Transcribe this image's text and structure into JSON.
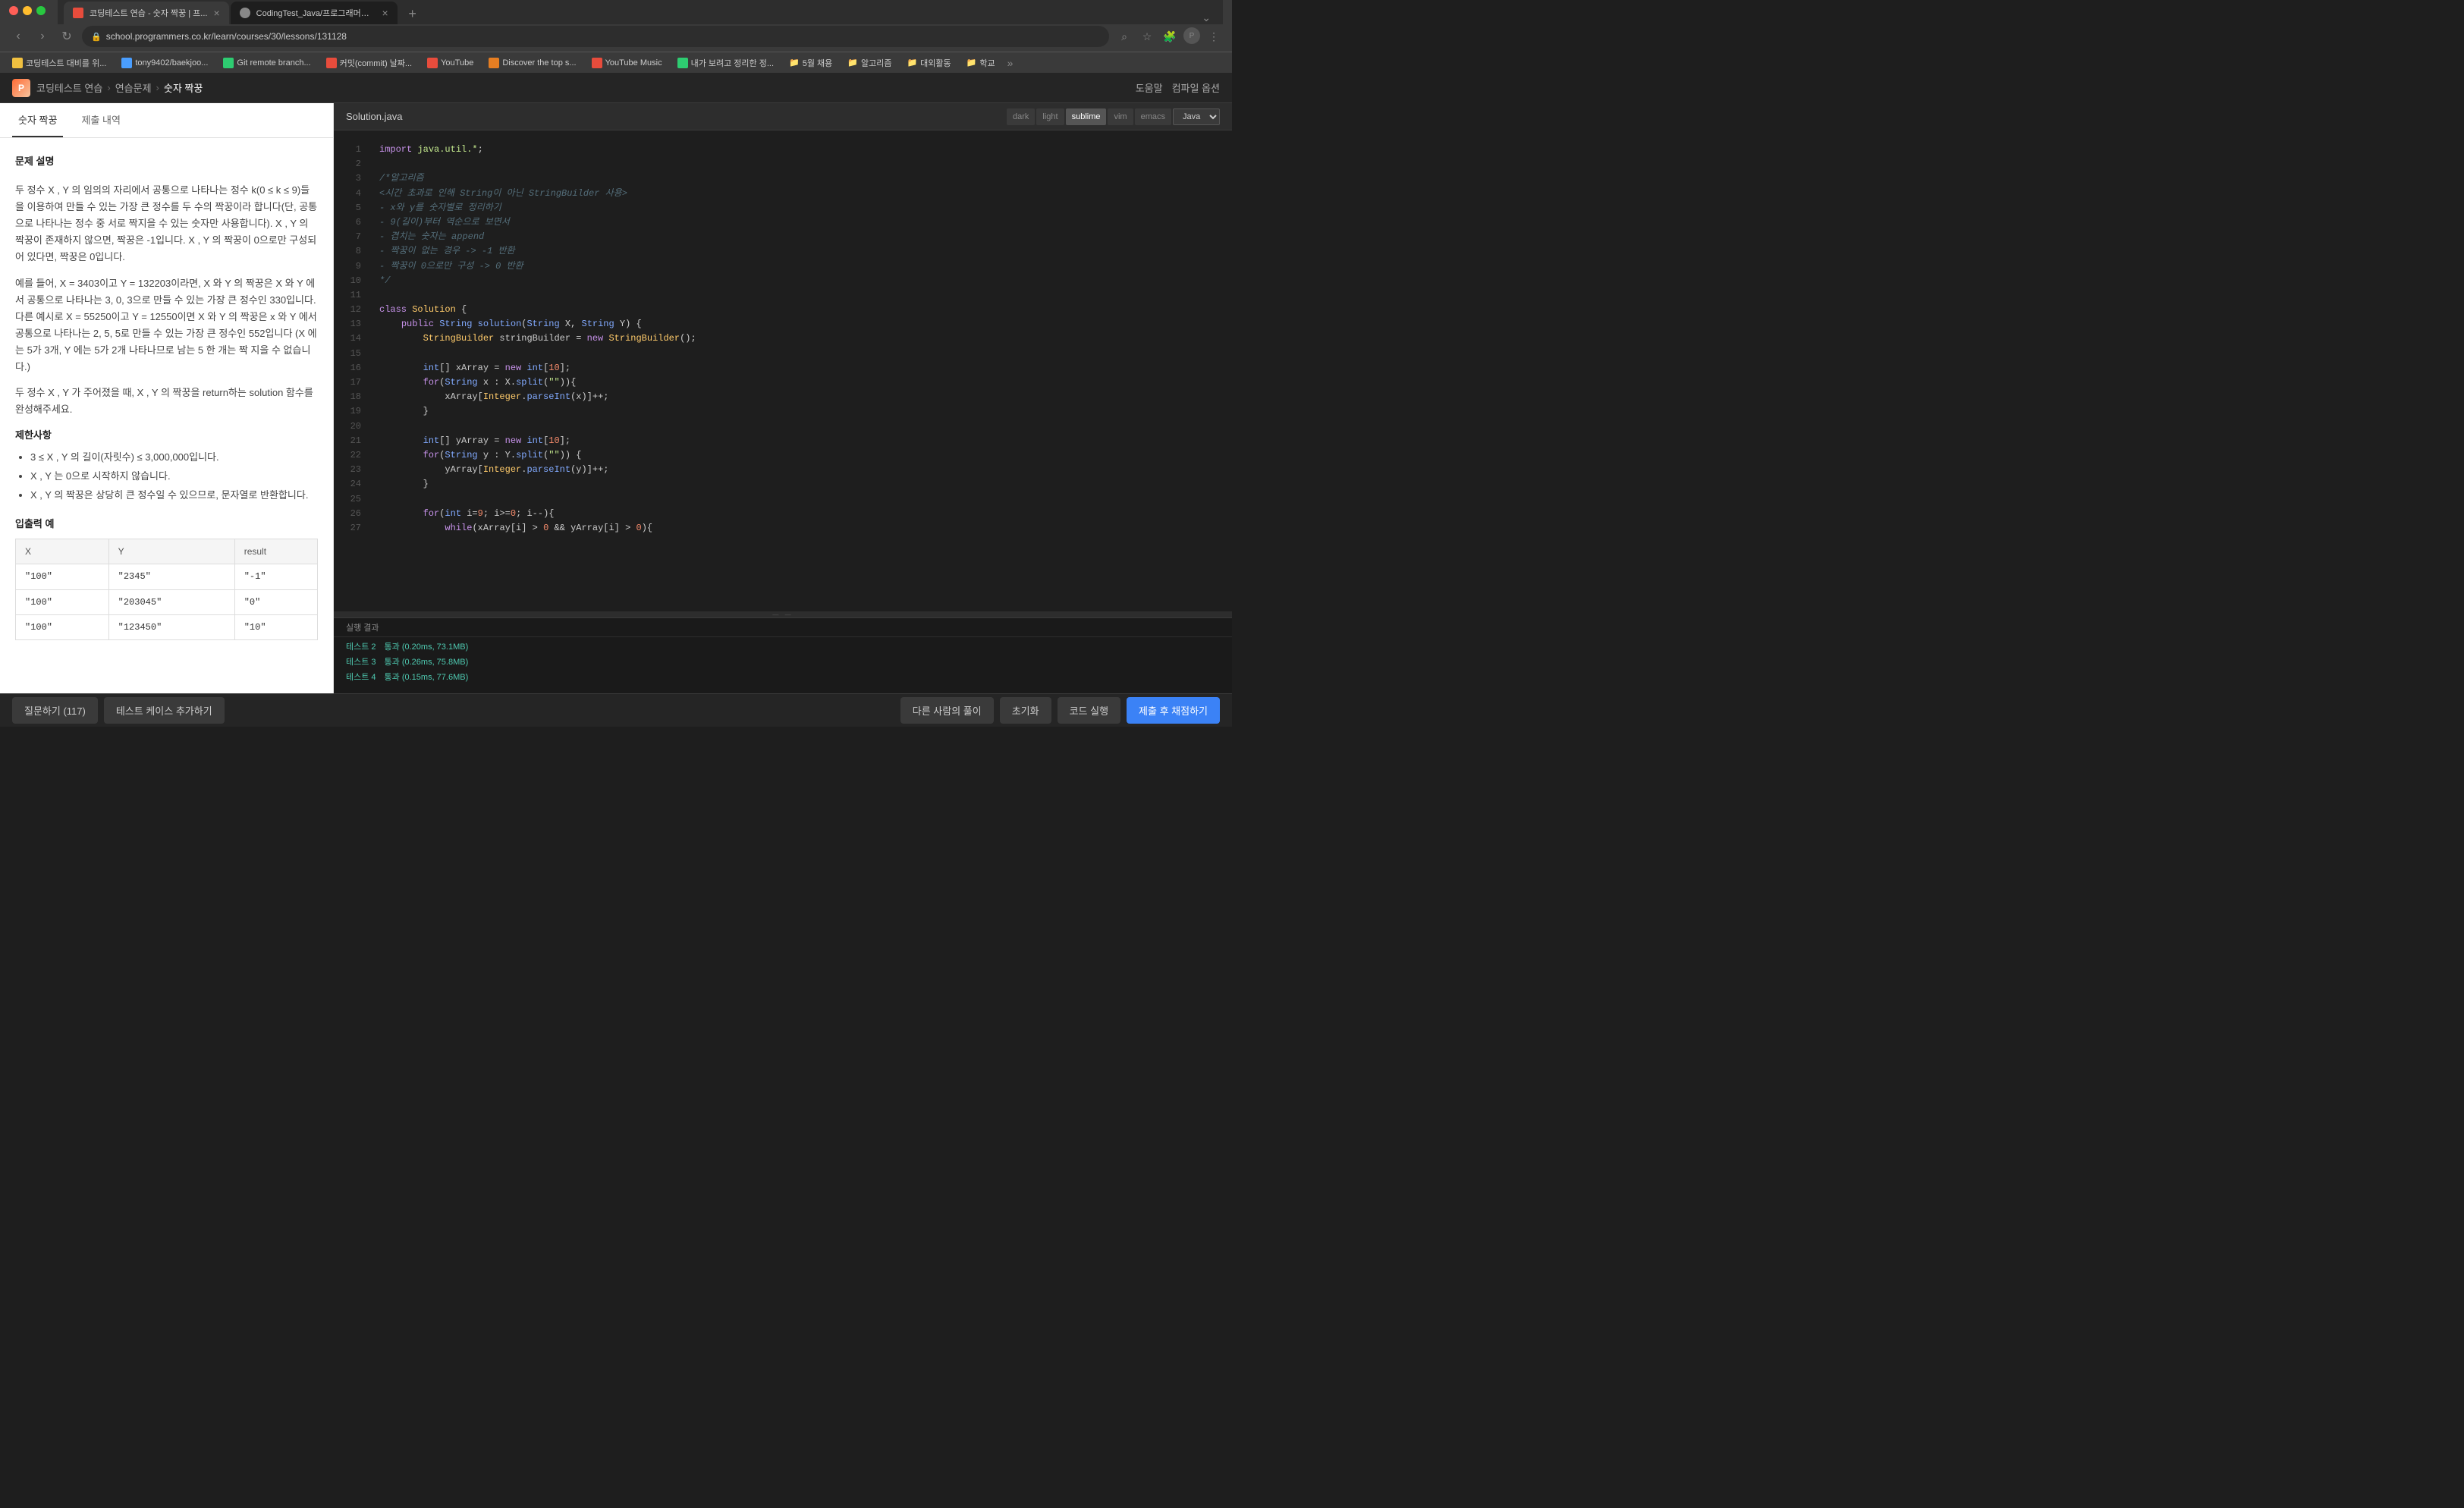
{
  "browser": {
    "tabs": [
      {
        "id": "tab1",
        "label": "코딩테스트 연습 - 숫자 짝꿍 | 프...",
        "favicon_color": "#e74c3c",
        "active": true
      },
      {
        "id": "tab2",
        "label": "CodingTest_Java/프로그래머스/...",
        "favicon_type": "github",
        "active": false
      }
    ],
    "new_tab_label": "+",
    "address": "school.programmers.co.kr/learn/courses/30/lessons/131128",
    "bookmarks": [
      {
        "id": "bm1",
        "label": "코딩테스트 대비를 위...",
        "color": "#f0c040"
      },
      {
        "id": "bm2",
        "label": "tony9402/baekjoo...",
        "color": "#4a9eff"
      },
      {
        "id": "bm3",
        "label": "Git remote branch...",
        "color": "#2ecc71"
      },
      {
        "id": "bm4",
        "label": "커밋(commit) 날짜...",
        "color": "#e74c3c"
      },
      {
        "id": "bm5",
        "label": "YouTube",
        "color": "#e74c3c"
      },
      {
        "id": "bm6",
        "label": "Discover the top s...",
        "color": "#e67e22"
      },
      {
        "id": "bm7",
        "label": "YouTube Music",
        "color": "#e74c3c"
      },
      {
        "id": "bm8",
        "label": "내가 보려고 정리한 정...",
        "color": "#2ecc71"
      },
      {
        "id": "bm9",
        "label": "5월 채용",
        "color": "#888",
        "is_folder": true
      },
      {
        "id": "bm10",
        "label": "알고리즘",
        "color": "#888",
        "is_folder": true
      },
      {
        "id": "bm11",
        "label": "대외활동",
        "color": "#888",
        "is_folder": true
      },
      {
        "id": "bm12",
        "label": "학교",
        "color": "#888",
        "is_folder": true
      }
    ]
  },
  "app": {
    "logo": "P",
    "breadcrumb": {
      "parts": [
        "코딩테스트 연습",
        "연습문제",
        "숫자 짝꿍"
      ]
    },
    "header_actions": [
      "도움말",
      "컴파일 옵션"
    ]
  },
  "tabs": {
    "problem": "숫자 짝꿍",
    "submission": "제출 내역"
  },
  "problem": {
    "description_label": "문제 설명",
    "description": [
      "두 정수 X , Y 의 임의의 자리에서 공통으로 나타나는 정수 k(0 ≤ k ≤ 9)들을 이용하여 만들 수 있는 가장 큰 정수를 두 수의 짝꿍이라 합니다(단, 공통으로 나타나는 정수 중 서로 짝지을 수 있는 숫자만 사용합니다). X , Y 의 짝꿍이 존재하지 않으면, 짝꿍은 -1입니다. X , Y 의 짝꿍이 0으로만 구성되어 있다면, 짝꿍은 0입니다.",
      "예를 들어, X = 3403이고 Y = 132203이라면, X 와 Y 의 짝꿍은 X 와 Y 에서 공통으로 나타나는 3, 0, 3으로 만들 수 있는 가장 큰 정수인 330입니다. 다른 예시로 X = 55250이고 Y = 12550이면 X 와 Y 의 짝꿍은 x 와 Y 에서 공통으로 나타나는 2, 5, 5로 만들 수 있는 가장 큰 정수인 552입니다 (X 에는 5가 3개, Y 에는 5가 2개 나타나므로 남는 5 한 개는 짝 지을 수 없습니다.)",
      "두 정수 X , Y 가 주어졌을 때, X , Y 의 짝꿍을 return하는 solution 함수를 완성해주세요."
    ],
    "constraints_label": "제한사항",
    "constraints": [
      "3 ≤ X , Y 의 길이(자릿수) ≤ 3,000,000입니다.",
      "X , Y 는 0으로 시작하지 않습니다.",
      "X , Y 의 짝꿍은 상당히 큰 정수일 수 있으므로, 문자열로 반환합니다."
    ],
    "io_label": "입출력 예",
    "io_table": {
      "headers": [
        "X",
        "Y",
        "result"
      ],
      "rows": [
        [
          "\"100\"",
          "\"2345\"",
          "\"-1\""
        ],
        [
          "\"100\"",
          "\"203045\"",
          "\"0\""
        ],
        [
          "\"100\"",
          "\"123450\"",
          "\"10\""
        ]
      ]
    }
  },
  "editor": {
    "file_name": "Solution.java",
    "themes": [
      "dark",
      "light",
      "sublime",
      "vim",
      "emacs"
    ],
    "active_theme": "sublime",
    "language": "Java",
    "line_count": 27,
    "code_lines": [
      {
        "n": 1,
        "text": "import java.util.*;"
      },
      {
        "n": 2,
        "text": ""
      },
      {
        "n": 3,
        "text": "/*알고리즘"
      },
      {
        "n": 4,
        "text": "<시간 초과로 인해 String이 아닌 StringBuilder 사용>"
      },
      {
        "n": 5,
        "text": "- x와 y를 숫자별로 정리하기"
      },
      {
        "n": 6,
        "text": "- 9(길이)부터 역순으로 보면서"
      },
      {
        "n": 7,
        "text": "  - 겹치는 숫자는 append"
      },
      {
        "n": 8,
        "text": "- 짝꿍이 없는 경우 -> -1 반환"
      },
      {
        "n": 9,
        "text": "- 짝꿍이 0으로만 구성 -> 0 반환"
      },
      {
        "n": 10,
        "text": "*/"
      },
      {
        "n": 11,
        "text": ""
      },
      {
        "n": 12,
        "text": "class Solution {"
      },
      {
        "n": 13,
        "text": "    public String solution(String X, String Y) {"
      },
      {
        "n": 14,
        "text": "        StringBuilder stringBuilder = new StringBuilder();"
      },
      {
        "n": 15,
        "text": ""
      },
      {
        "n": 16,
        "text": "        int[] xArray = new int[10];"
      },
      {
        "n": 17,
        "text": "        for(String x : X.split(\"\")) {"
      },
      {
        "n": 18,
        "text": "            xArray[Integer.parseInt(x)]++;"
      },
      {
        "n": 19,
        "text": "        }"
      },
      {
        "n": 20,
        "text": ""
      },
      {
        "n": 21,
        "text": "        int[] yArray = new int[10];"
      },
      {
        "n": 22,
        "text": "        for(String y : Y.split(\"\")) {"
      },
      {
        "n": 23,
        "text": "            yArray[Integer.parseInt(y)]++;"
      },
      {
        "n": 24,
        "text": "        }"
      },
      {
        "n": 25,
        "text": ""
      },
      {
        "n": 26,
        "text": "        for(int i=9; i>=0; i--){"
      },
      {
        "n": 27,
        "text": "            while(xArray[i] > 0 && yArray[i] > 0){"
      }
    ]
  },
  "output": {
    "label": "실행 결과",
    "results": [
      {
        "id": "test2",
        "label": "테스트 2",
        "status": "통과 (0.20ms, 73.1MB)"
      },
      {
        "id": "test3",
        "label": "테스트 3",
        "status": "통과 (0.26ms, 75.8MB)"
      },
      {
        "id": "test4",
        "label": "테스트 4",
        "status": "통과 (0.15ms, 77.6MB)"
      }
    ]
  },
  "bottom_bar": {
    "left_buttons": [
      {
        "id": "question-btn",
        "label": "질문하기 (117)"
      },
      {
        "id": "testcase-btn",
        "label": "테스트 케이스 추가하기"
      }
    ],
    "right_buttons": [
      {
        "id": "other-solutions-btn",
        "label": "다른 사람의 풀이"
      },
      {
        "id": "reset-btn",
        "label": "초기화"
      },
      {
        "id": "run-btn",
        "label": "코드 실행"
      },
      {
        "id": "submit-btn",
        "label": "제출 후 채점하기"
      }
    ]
  }
}
